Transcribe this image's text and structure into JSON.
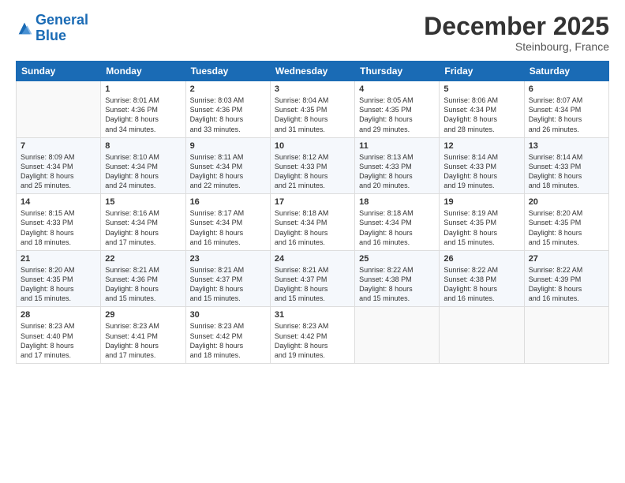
{
  "header": {
    "logo_line1": "General",
    "logo_line2": "Blue",
    "month": "December 2025",
    "location": "Steinbourg, France"
  },
  "weekdays": [
    "Sunday",
    "Monday",
    "Tuesday",
    "Wednesday",
    "Thursday",
    "Friday",
    "Saturday"
  ],
  "weeks": [
    [
      {
        "day": "",
        "info": ""
      },
      {
        "day": "1",
        "info": "Sunrise: 8:01 AM\nSunset: 4:36 PM\nDaylight: 8 hours\nand 34 minutes."
      },
      {
        "day": "2",
        "info": "Sunrise: 8:03 AM\nSunset: 4:36 PM\nDaylight: 8 hours\nand 33 minutes."
      },
      {
        "day": "3",
        "info": "Sunrise: 8:04 AM\nSunset: 4:35 PM\nDaylight: 8 hours\nand 31 minutes."
      },
      {
        "day": "4",
        "info": "Sunrise: 8:05 AM\nSunset: 4:35 PM\nDaylight: 8 hours\nand 29 minutes."
      },
      {
        "day": "5",
        "info": "Sunrise: 8:06 AM\nSunset: 4:34 PM\nDaylight: 8 hours\nand 28 minutes."
      },
      {
        "day": "6",
        "info": "Sunrise: 8:07 AM\nSunset: 4:34 PM\nDaylight: 8 hours\nand 26 minutes."
      }
    ],
    [
      {
        "day": "7",
        "info": "Sunrise: 8:09 AM\nSunset: 4:34 PM\nDaylight: 8 hours\nand 25 minutes."
      },
      {
        "day": "8",
        "info": "Sunrise: 8:10 AM\nSunset: 4:34 PM\nDaylight: 8 hours\nand 24 minutes."
      },
      {
        "day": "9",
        "info": "Sunrise: 8:11 AM\nSunset: 4:34 PM\nDaylight: 8 hours\nand 22 minutes."
      },
      {
        "day": "10",
        "info": "Sunrise: 8:12 AM\nSunset: 4:33 PM\nDaylight: 8 hours\nand 21 minutes."
      },
      {
        "day": "11",
        "info": "Sunrise: 8:13 AM\nSunset: 4:33 PM\nDaylight: 8 hours\nand 20 minutes."
      },
      {
        "day": "12",
        "info": "Sunrise: 8:14 AM\nSunset: 4:33 PM\nDaylight: 8 hours\nand 19 minutes."
      },
      {
        "day": "13",
        "info": "Sunrise: 8:14 AM\nSunset: 4:33 PM\nDaylight: 8 hours\nand 18 minutes."
      }
    ],
    [
      {
        "day": "14",
        "info": "Sunrise: 8:15 AM\nSunset: 4:33 PM\nDaylight: 8 hours\nand 18 minutes."
      },
      {
        "day": "15",
        "info": "Sunrise: 8:16 AM\nSunset: 4:34 PM\nDaylight: 8 hours\nand 17 minutes."
      },
      {
        "day": "16",
        "info": "Sunrise: 8:17 AM\nSunset: 4:34 PM\nDaylight: 8 hours\nand 16 minutes."
      },
      {
        "day": "17",
        "info": "Sunrise: 8:18 AM\nSunset: 4:34 PM\nDaylight: 8 hours\nand 16 minutes."
      },
      {
        "day": "18",
        "info": "Sunrise: 8:18 AM\nSunset: 4:34 PM\nDaylight: 8 hours\nand 16 minutes."
      },
      {
        "day": "19",
        "info": "Sunrise: 8:19 AM\nSunset: 4:35 PM\nDaylight: 8 hours\nand 15 minutes."
      },
      {
        "day": "20",
        "info": "Sunrise: 8:20 AM\nSunset: 4:35 PM\nDaylight: 8 hours\nand 15 minutes."
      }
    ],
    [
      {
        "day": "21",
        "info": "Sunrise: 8:20 AM\nSunset: 4:35 PM\nDaylight: 8 hours\nand 15 minutes."
      },
      {
        "day": "22",
        "info": "Sunrise: 8:21 AM\nSunset: 4:36 PM\nDaylight: 8 hours\nand 15 minutes."
      },
      {
        "day": "23",
        "info": "Sunrise: 8:21 AM\nSunset: 4:37 PM\nDaylight: 8 hours\nand 15 minutes."
      },
      {
        "day": "24",
        "info": "Sunrise: 8:21 AM\nSunset: 4:37 PM\nDaylight: 8 hours\nand 15 minutes."
      },
      {
        "day": "25",
        "info": "Sunrise: 8:22 AM\nSunset: 4:38 PM\nDaylight: 8 hours\nand 15 minutes."
      },
      {
        "day": "26",
        "info": "Sunrise: 8:22 AM\nSunset: 4:38 PM\nDaylight: 8 hours\nand 16 minutes."
      },
      {
        "day": "27",
        "info": "Sunrise: 8:22 AM\nSunset: 4:39 PM\nDaylight: 8 hours\nand 16 minutes."
      }
    ],
    [
      {
        "day": "28",
        "info": "Sunrise: 8:23 AM\nSunset: 4:40 PM\nDaylight: 8 hours\nand 17 minutes."
      },
      {
        "day": "29",
        "info": "Sunrise: 8:23 AM\nSunset: 4:41 PM\nDaylight: 8 hours\nand 17 minutes."
      },
      {
        "day": "30",
        "info": "Sunrise: 8:23 AM\nSunset: 4:42 PM\nDaylight: 8 hours\nand 18 minutes."
      },
      {
        "day": "31",
        "info": "Sunrise: 8:23 AM\nSunset: 4:42 PM\nDaylight: 8 hours\nand 19 minutes."
      },
      {
        "day": "",
        "info": ""
      },
      {
        "day": "",
        "info": ""
      },
      {
        "day": "",
        "info": ""
      }
    ]
  ]
}
